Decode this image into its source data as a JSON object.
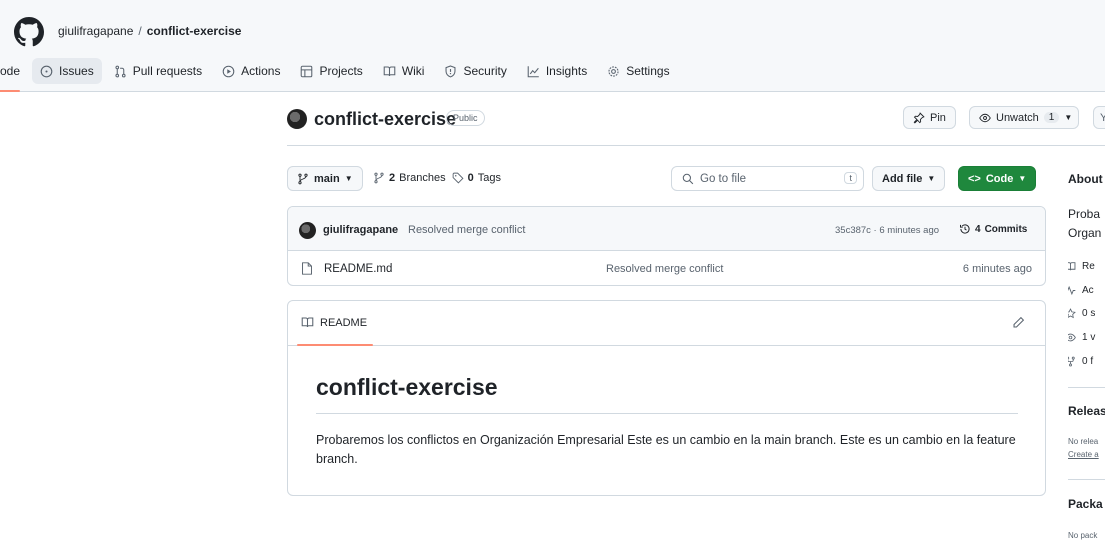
{
  "header": {
    "owner": "giulifragapane",
    "separator": "/",
    "repo": "conflict-exercise"
  },
  "nav": [
    {
      "label": "ode",
      "icon": "code-icon"
    },
    {
      "label": "Issues",
      "icon": "issue-icon"
    },
    {
      "label": "Pull requests",
      "icon": "pull-request-icon"
    },
    {
      "label": "Actions",
      "icon": "play-icon"
    },
    {
      "label": "Projects",
      "icon": "table-icon"
    },
    {
      "label": "Wiki",
      "icon": "book-icon"
    },
    {
      "label": "Security",
      "icon": "shield-icon"
    },
    {
      "label": "Insights",
      "icon": "graph-icon"
    },
    {
      "label": "Settings",
      "icon": "gear-icon"
    }
  ],
  "repo": {
    "title": "conflict-exercise",
    "visibility": "Public",
    "pin_label": "Pin",
    "unwatch_label": "Unwatch",
    "watch_count": "1",
    "fork_label": "Y"
  },
  "toolbar": {
    "branch": "main",
    "branches_count": "2",
    "branches_label": "Branches",
    "tags_count": "0",
    "tags_label": "Tags",
    "search_placeholder": "Go to file",
    "search_kbd": "t",
    "add_file_label": "Add file",
    "code_label": "Code"
  },
  "commit": {
    "author": "giulifragapane",
    "message": "Resolved merge conflict",
    "hash_time": "35c387c · 6 minutes ago",
    "commits_count": "4",
    "commits_label": "Commits"
  },
  "files": [
    {
      "name": "README.md",
      "message": "Resolved merge conflict",
      "time": "6 minutes ago"
    }
  ],
  "readme": {
    "tab_label": "README",
    "heading": "conflict-exercise",
    "body": "Probaremos los conflictos en Organización Empresarial Este es un cambio en la main branch. Este es un cambio en la feature branch."
  },
  "sidebar": {
    "about_title": "About",
    "about_line1": "Proba",
    "about_line2": "Organ",
    "meta": [
      {
        "icon": "book-icon",
        "text": "Re"
      },
      {
        "icon": "pulse-icon",
        "text": "Ac"
      },
      {
        "icon": "star-icon",
        "text": "0 s"
      },
      {
        "icon": "eye-icon",
        "text": "1 v"
      },
      {
        "icon": "fork-icon",
        "text": "0 f"
      }
    ],
    "releases_title": "Releas",
    "releases_none": "No relea",
    "releases_link": "Create a",
    "packages_title": "Packa",
    "packages_none": "No pack"
  },
  "colors": {
    "accent_orange": "#fd8c73",
    "primary_green": "#1f883d",
    "link_blue": "#0969da",
    "border": "#d1d9e0"
  }
}
